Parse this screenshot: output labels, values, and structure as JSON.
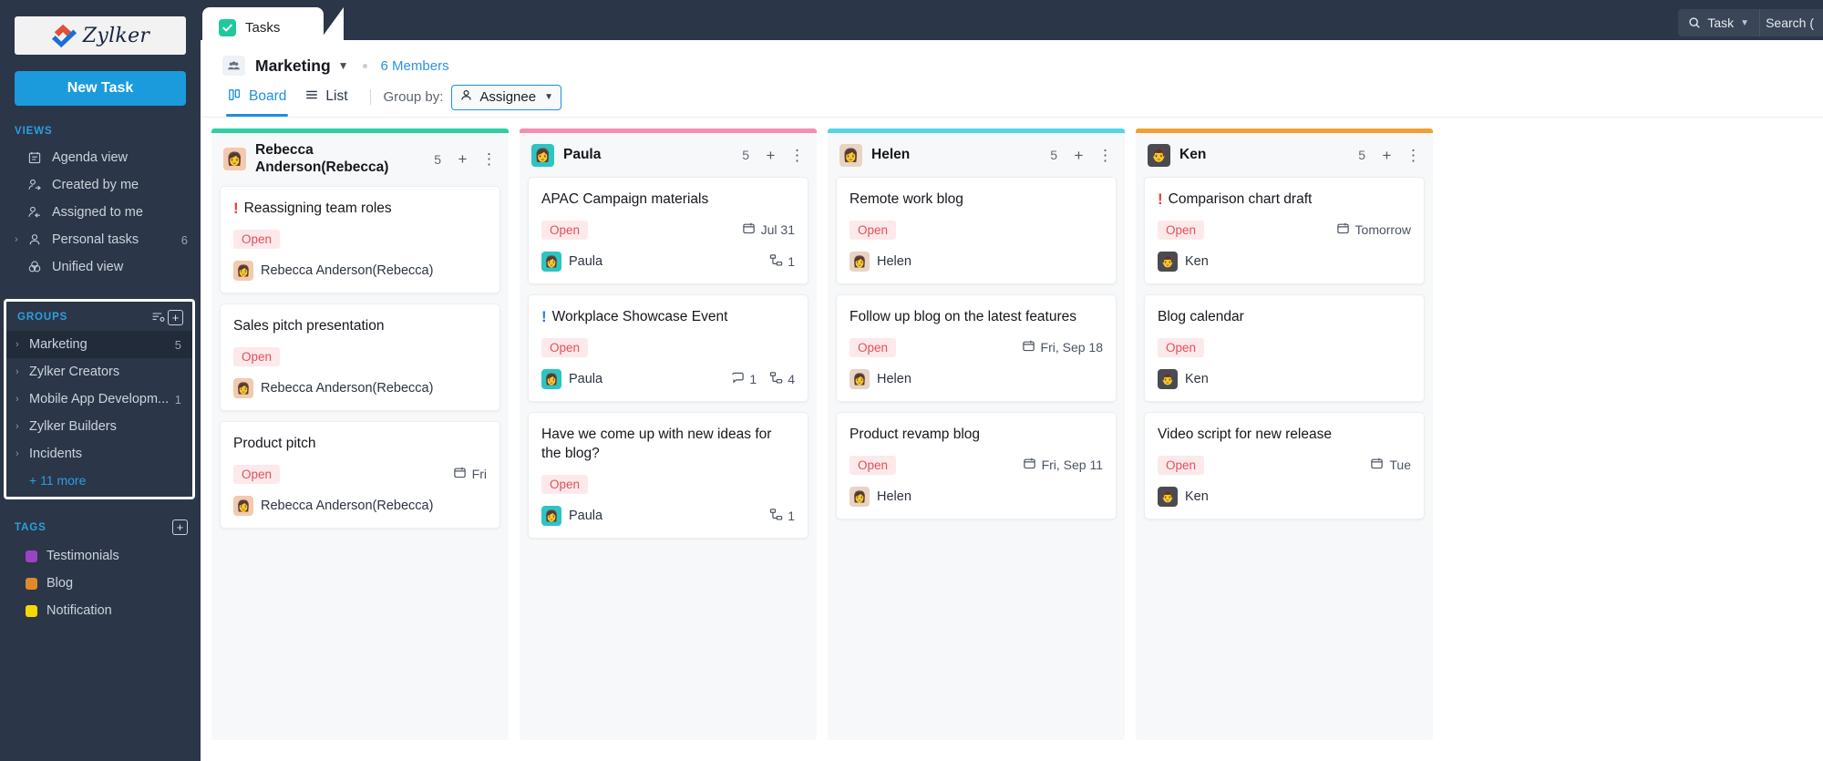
{
  "brand": {
    "name": "Zylker"
  },
  "sidebar": {
    "new_task_label": "New Task",
    "views_label": "VIEWS",
    "views": [
      {
        "label": "Agenda view",
        "icon": "agenda-icon",
        "count": "",
        "expandable": false
      },
      {
        "label": "Created by me",
        "icon": "user-out-icon",
        "count": "",
        "expandable": false
      },
      {
        "label": "Assigned to me",
        "icon": "user-in-icon",
        "count": "",
        "expandable": false
      },
      {
        "label": "Personal tasks",
        "icon": "user-icon",
        "count": "6",
        "expandable": true
      },
      {
        "label": "Unified view",
        "icon": "unified-icon",
        "count": "",
        "expandable": false
      }
    ],
    "groups_label": "GROUPS",
    "groups": [
      {
        "label": "Marketing",
        "count": "5",
        "active": true
      },
      {
        "label": "Zylker Creators",
        "count": "",
        "active": false
      },
      {
        "label": "Mobile App Developm...",
        "count": "1",
        "active": false
      },
      {
        "label": "Zylker Builders",
        "count": "",
        "active": false
      },
      {
        "label": "Incidents",
        "count": "",
        "active": false
      }
    ],
    "groups_more": "+ 11 more",
    "tags_label": "TAGS",
    "tags": [
      {
        "label": "Testimonials",
        "color": "#9b43c4"
      },
      {
        "label": "Blog",
        "color": "#e0892b"
      },
      {
        "label": "Notification",
        "color": "#f5d800"
      }
    ]
  },
  "topbar": {
    "tab_label": "Tasks",
    "search_scope": "Task",
    "search_text": "Search ("
  },
  "header": {
    "group_name": "Marketing",
    "members": "6 Members",
    "tabs": [
      {
        "label": "Board",
        "icon": "board-icon",
        "active": true
      },
      {
        "label": "List",
        "icon": "list-icon",
        "active": false
      }
    ],
    "group_by_label": "Group by:",
    "group_by_value": "Assignee"
  },
  "board": {
    "columns": [
      {
        "name": "Rebecca Anderson(Rebecca)",
        "short": "Rebecca",
        "accent": "#2ecfa5",
        "count": "5",
        "avatar_bg": "#f3c9b0",
        "avatar_glyph": "👩",
        "cards": [
          {
            "title": "Reassigning team roles",
            "priority": "high",
            "status": "Open",
            "due": "",
            "assignee": "Rebecca Anderson(Rebecca)",
            "comments": "",
            "subtasks": ""
          },
          {
            "title": "Sales pitch presentation",
            "priority": "",
            "status": "Open",
            "due": "",
            "assignee": "Rebecca Anderson(Rebecca)",
            "comments": "",
            "subtasks": ""
          },
          {
            "title": "Product pitch",
            "priority": "",
            "status": "Open",
            "due": "Fri",
            "assignee": "Rebecca Anderson(Rebecca)",
            "comments": "",
            "subtasks": ""
          }
        ]
      },
      {
        "name": "Paula",
        "short": "Paula",
        "accent": "#f48fb1",
        "count": "5",
        "avatar_bg": "#2ec4c4",
        "avatar_glyph": "👩",
        "cards": [
          {
            "title": "APAC Campaign materials",
            "priority": "",
            "status": "Open",
            "due": "Jul 31",
            "assignee": "Paula",
            "comments": "",
            "subtasks": "1"
          },
          {
            "title": "Workplace Showcase Event",
            "priority": "low",
            "status": "Open",
            "due": "",
            "assignee": "Paula",
            "comments": "1",
            "subtasks": "4"
          },
          {
            "title": "Have we come up with new ideas for the blog?",
            "priority": "",
            "status": "Open",
            "due": "",
            "assignee": "Paula",
            "comments": "",
            "subtasks": "1"
          }
        ]
      },
      {
        "name": "Helen",
        "short": "Helen",
        "accent": "#4fd6e8",
        "count": "5",
        "avatar_bg": "#e8d3c4",
        "avatar_glyph": "👩",
        "cards": [
          {
            "title": "Remote work blog",
            "priority": "",
            "status": "Open",
            "due": "",
            "assignee": "Helen",
            "comments": "",
            "subtasks": ""
          },
          {
            "title": "Follow up blog on the latest features",
            "priority": "",
            "status": "Open",
            "due": "Fri, Sep 18",
            "assignee": "Helen",
            "comments": "",
            "subtasks": ""
          },
          {
            "title": "Product revamp blog",
            "priority": "",
            "status": "Open",
            "due": "Fri, Sep 11",
            "assignee": "Helen",
            "comments": "",
            "subtasks": ""
          }
        ]
      },
      {
        "name": "Ken",
        "short": "Ken",
        "accent": "#f0a030",
        "count": "5",
        "avatar_bg": "#4a4a52",
        "avatar_glyph": "👨",
        "cards": [
          {
            "title": "Comparison chart draft",
            "priority": "high",
            "status": "Open",
            "due": "Tomorrow",
            "assignee": "Ken",
            "comments": "",
            "subtasks": ""
          },
          {
            "title": "Blog calendar",
            "priority": "",
            "status": "Open",
            "due": "",
            "assignee": "Ken",
            "comments": "",
            "subtasks": ""
          },
          {
            "title": "Video script for new release",
            "priority": "",
            "status": "Open",
            "due": "Tue",
            "assignee": "Ken",
            "comments": "",
            "subtasks": ""
          }
        ]
      }
    ]
  }
}
